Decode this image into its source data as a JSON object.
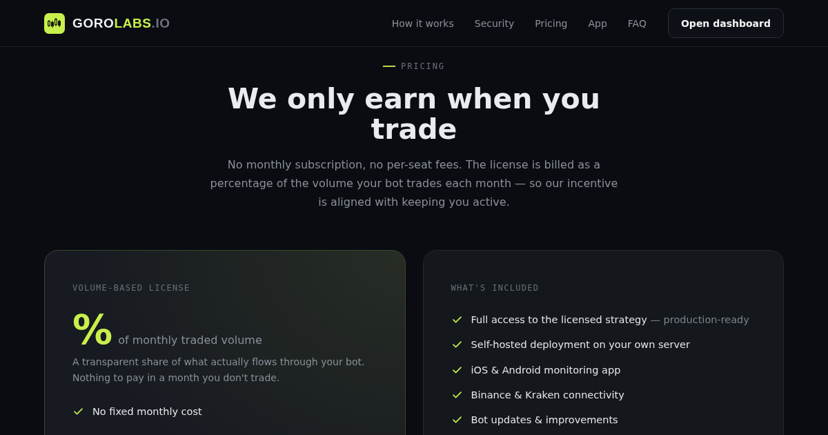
{
  "header": {
    "brand": [
      {
        "text": "GORO",
        "kind": "base"
      },
      {
        "text": "LABS",
        "kind": "accent"
      },
      {
        "text": ".IO",
        "kind": "muted"
      }
    ],
    "nav": [
      "How it works",
      "Security",
      "Pricing",
      "App",
      "FAQ"
    ],
    "cta": "Open dashboard"
  },
  "hero": {
    "eyebrow": "PRICING",
    "title": "We only earn when you trade",
    "lead": "No monthly subscription, no per-seat fees. The license is billed as a percentage of the volume your bot trades each month — so our incentive is aligned with keeping you active."
  },
  "license_card": {
    "label": "VOLUME-BASED LICENSE",
    "symbol": "%",
    "unit": "of monthly traded volume",
    "description": "A transparent share of what actually flows through your bot. Nothing to pay in a month you don't trade.",
    "features": [
      {
        "text": "No fixed monthly cost"
      }
    ]
  },
  "included_card": {
    "label": "WHAT'S INCLUDED",
    "features": [
      {
        "text": "Full access to the licensed strategy",
        "note": "— production-ready"
      },
      {
        "text": "Self-hosted deployment on your own server"
      },
      {
        "text": "iOS & Android monitoring app"
      },
      {
        "text": "Binance & Kraken connectivity"
      },
      {
        "text": "Bot updates & improvements"
      }
    ]
  }
}
